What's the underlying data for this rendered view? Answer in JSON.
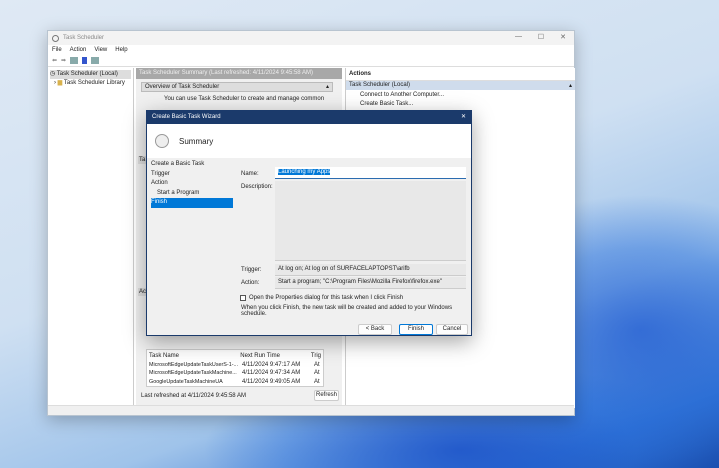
{
  "window": {
    "title": "Task Scheduler",
    "menu": [
      "File",
      "Action",
      "View",
      "Help"
    ]
  },
  "tree": {
    "items": [
      "Task Scheduler (Local)",
      "Task Scheduler Library"
    ]
  },
  "middle": {
    "header": "Task Scheduler Summary (Last refreshed: 4/11/2024 9:45:58 AM)",
    "overview_title": "Overview of Task Scheduler",
    "overview_text": "You can use Task Scheduler to create and manage common",
    "tab_stub": "Ta",
    "act_stub": "Act",
    "table": {
      "columns": [
        "Task Name",
        "Next Run Time",
        "Trig"
      ],
      "rows": [
        [
          "MicrosoftEdgeUpdateTaskUserS-1-...",
          "4/11/2024 9:47:17 AM",
          "At"
        ],
        [
          "MicrosoftEdgeUpdateTaskMachine...",
          "4/11/2024 9:47:34 AM",
          "At"
        ],
        [
          "GoogleUpdateTaskMachineUA",
          "4/11/2024 9:49:05 AM",
          "At"
        ]
      ]
    },
    "last_refreshed": "Last refreshed at 4/11/2024 9:45:58 AM",
    "refresh": "Refresh"
  },
  "actions": {
    "title": "Actions",
    "section": "Task Scheduler (Local)",
    "items": [
      "Connect to Another Computer...",
      "Create Basic Task..."
    ]
  },
  "dialog": {
    "title": "Create Basic Task Wizard",
    "heading": "Summary",
    "steps": [
      "Create a Basic Task",
      "Trigger",
      "Action",
      "Start a Program",
      "Finish"
    ],
    "name_label": "Name:",
    "name_value": "Launching my Apps",
    "description_label": "Description:",
    "trigger_label": "Trigger:",
    "trigger_value": "At log on; At log on of SURFACELAPTOPST\\arifb",
    "action_label": "Action:",
    "action_value": "Start a program; \"C:\\Program Files\\Mozilla Firefox\\firefox.exe\"",
    "checkbox_label": "Open the Properties dialog for this task when I click Finish",
    "info": "When you click Finish, the new task will be created and added to your Windows schedule.",
    "back": "< Back",
    "finish": "Finish",
    "cancel": "Cancel",
    "close": "✕"
  }
}
